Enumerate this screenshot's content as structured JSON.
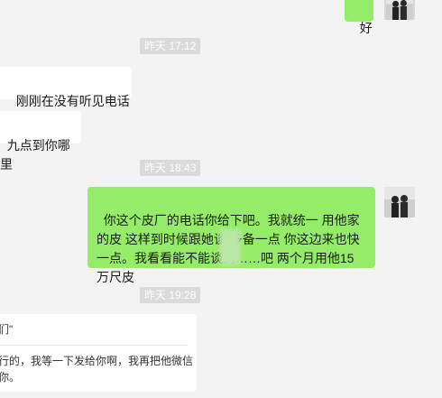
{
  "messages": [
    {
      "direction": "out",
      "text": "好"
    },
    {
      "direction": "in",
      "text": "刚刚在没有听见电话"
    },
    {
      "direction": "in",
      "text": "九点到你哪里"
    },
    {
      "direction": "out",
      "text": "你这个皮厂的电话你给下吧。我就统一 用他家的皮 这样到时候跟她谈 多备一点 你这边来也快一点。我看看能不能谈到……吧 两个月用他15万尺皮"
    },
    {
      "direction": "in",
      "quote_top": "们\"",
      "quote_body": "行的，我等一下发给你啊，我再把他微信\n你。"
    }
  ],
  "timestamps": [
    "昨天 17:12",
    "昨天 18:43",
    "昨天 19:28"
  ],
  "avatar": {
    "icon": "profile-photo-silhouettes"
  },
  "colors": {
    "background": "#f3f3f3",
    "incoming_bubble": "#ffffff",
    "outgoing_bubble": "#95ec69",
    "timestamp_chip": "#dadada"
  }
}
